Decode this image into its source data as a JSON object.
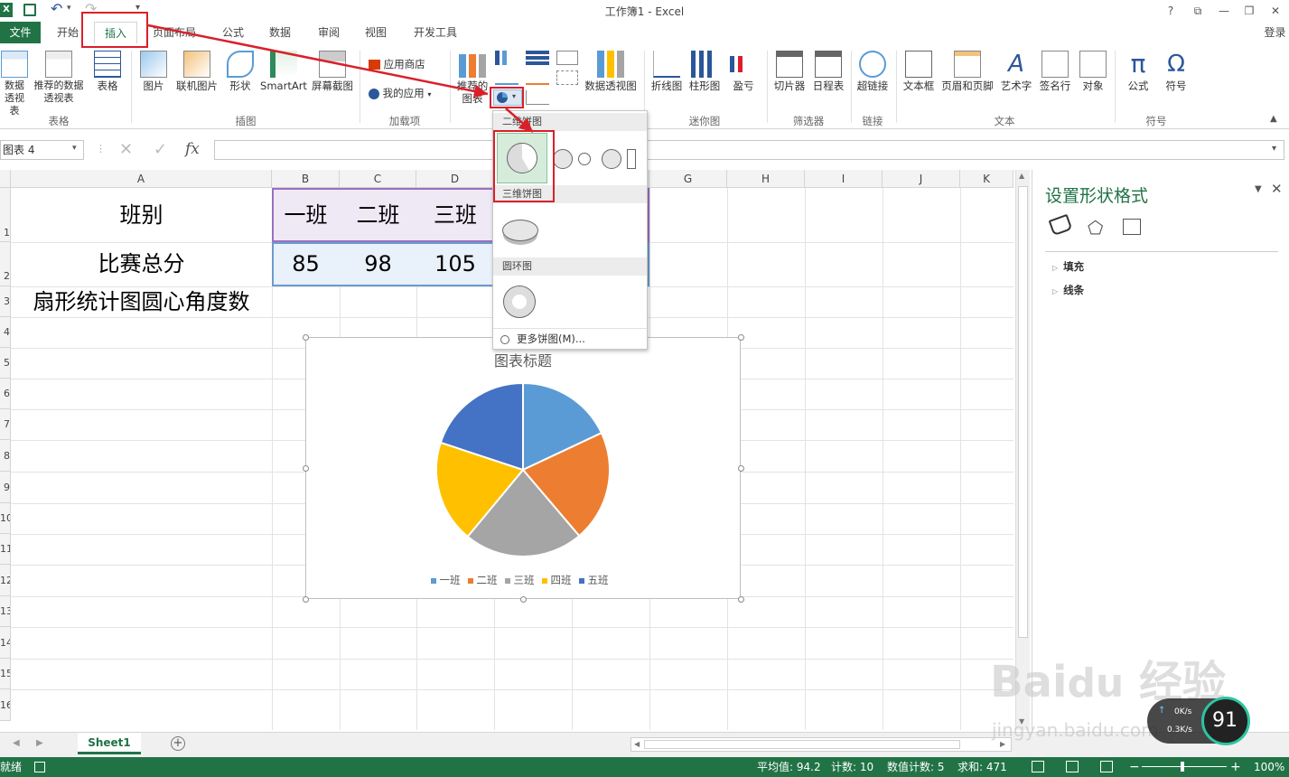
{
  "window": {
    "title": "工作簿1 - Excel",
    "help": "?",
    "login": "登录"
  },
  "tabs": [
    "文件",
    "开始",
    "插入",
    "页面布局",
    "公式",
    "数据",
    "审阅",
    "视图",
    "开发工具"
  ],
  "ribbon": {
    "groups": [
      "表格",
      "插图",
      "加载项",
      "迷你图",
      "筛选器",
      "链接",
      "文本",
      "符号"
    ],
    "table_buttons": [
      "数据透视表",
      "推荐的数据透视表",
      "表格"
    ],
    "illus_buttons": [
      "图片",
      "联机图片",
      "形状",
      "SmartArt",
      "屏幕截图"
    ],
    "addin_buttons": [
      "应用商店",
      "我的应用"
    ],
    "chart_buttons": [
      "推荐的图表",
      "数据透视图"
    ],
    "spark_buttons": [
      "折线图",
      "柱形图",
      "盈亏"
    ],
    "filter_buttons": [
      "切片器",
      "日程表"
    ],
    "link_buttons": [
      "超链接"
    ],
    "text_buttons": [
      "文本框",
      "页眉和页脚",
      "艺术字",
      "签名行",
      "对象"
    ],
    "symbol_buttons": [
      "公式",
      "符号"
    ]
  },
  "formula_bar": {
    "name_box": "图表 4",
    "fx": "fx"
  },
  "grid": {
    "columns": [
      "A",
      "B",
      "C",
      "D",
      "E",
      "F",
      "G",
      "H",
      "I",
      "J",
      "K"
    ],
    "rows": [
      "1",
      "2",
      "3",
      "4",
      "5",
      "6",
      "7",
      "8",
      "9",
      "10",
      "11",
      "12",
      "13",
      "14",
      "15",
      "16"
    ],
    "a1": "班别",
    "a2": "比赛总分",
    "a3": "扇形统计图圆心角度数",
    "b1": "一班",
    "c1": "二班",
    "d1": "三班",
    "b2": "85",
    "c2": "98",
    "d2": "105"
  },
  "dropdown": {
    "h2d": "二维饼图",
    "h3d": "三维饼图",
    "hdonut": "圆环图",
    "more": "更多饼图(M)..."
  },
  "chart_data": {
    "type": "pie",
    "title": "图表标题",
    "categories": [
      "一班",
      "二班",
      "三班",
      "四班",
      "五班"
    ],
    "values": [
      85,
      98,
      105,
      90,
      94
    ],
    "colors": [
      "#5b9bd5",
      "#ed7d31",
      "#a5a5a5",
      "#ffc000",
      "#4472c4"
    ],
    "legend": "bottom"
  },
  "pane": {
    "title": "设置形状格式",
    "fill": "填充",
    "line": "线条"
  },
  "sheets": {
    "active": "Sheet1"
  },
  "status": {
    "ready": "就绪",
    "avg": "平均值: 94.2",
    "count": "计数: 10",
    "numcount": "数值计数: 5",
    "sum": "求和: 471",
    "zoom": "100%"
  },
  "watermark": {
    "site": "jingyan.baidu.com",
    "speed_up": "0K/s",
    "speed_down": "0.3K/s",
    "percent": "91"
  }
}
